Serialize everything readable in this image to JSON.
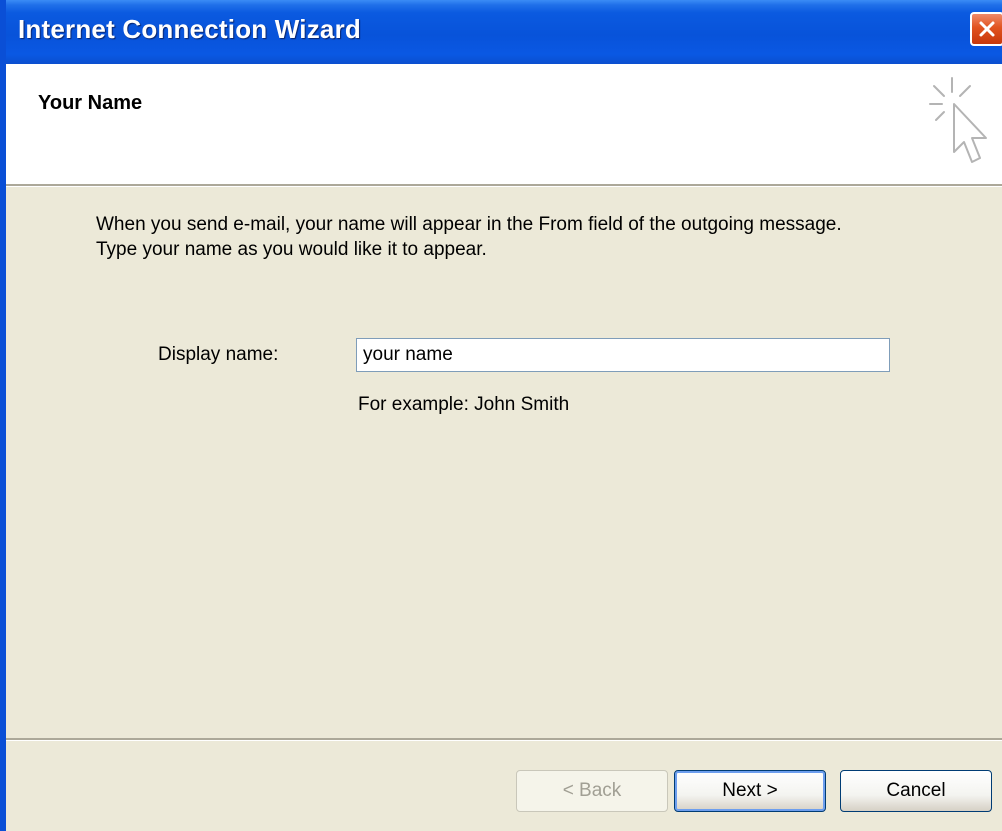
{
  "window": {
    "title": "Internet Connection Wizard"
  },
  "header": {
    "title": "Your Name",
    "icon": "wizard-cursor-icon"
  },
  "body": {
    "intro_line1": "When you send e-mail, your name will appear in the From field of the outgoing message.",
    "intro_line2": "Type your name as you would like it to appear.",
    "display_name_label": "Display name:",
    "display_name_value": "your name",
    "example": "For example: John Smith"
  },
  "buttons": {
    "back_label": "< Back",
    "next_label": "Next >",
    "cancel_label": "Cancel"
  },
  "colors": {
    "titlebar": "#0853da",
    "close": "#e1531f",
    "dialog_bg": "#ece9d8"
  }
}
